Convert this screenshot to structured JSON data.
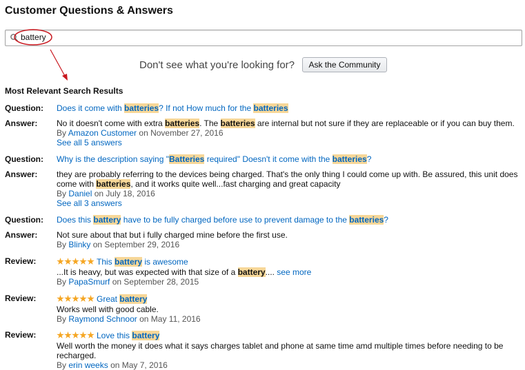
{
  "header": {
    "title": "Customer Questions & Answers"
  },
  "search": {
    "value": "battery",
    "icon": "search-icon"
  },
  "cta": {
    "text": "Don't see what you're looking for?",
    "button_label": "Ask the Community"
  },
  "results": {
    "heading": "Most Relevant Search Results",
    "labels": {
      "question": "Question:",
      "answer": "Answer:",
      "review": "Review:"
    },
    "qa": [
      {
        "question": [
          "Does it come with ",
          "batteries",
          "? If not How much for the ",
          "batteries"
        ],
        "answer": [
          "No it doesn't come with extra ",
          "batteries",
          ". The ",
          "batteries",
          " are internal but not sure if they are replaceable or if you can buy them."
        ],
        "by": "By",
        "author": "Amazon Customer",
        "date": "on November 27, 2016",
        "see_all": "See all 5 answers"
      },
      {
        "question": [
          "Why is the description saying \"",
          "Batteries",
          " required\" Doesn't it come with the ",
          "batteries",
          "?"
        ],
        "answer": [
          "they are probably referring to the devices being charged. That's the only thing I could come up with. Be assured, this unit does come with ",
          "batteries",
          ", and it works quite well...fast charging and great capacity"
        ],
        "by": "By",
        "author": "Daniel",
        "date": "on July 18, 2016",
        "see_all": "See all 3 answers"
      },
      {
        "question": [
          "Does this ",
          "battery",
          " have to be fully charged before use to prevent damage to the ",
          "batteries",
          "?"
        ],
        "answer": [
          "Not sure about that but i fully charged mine before the first use."
        ],
        "by": "By",
        "author": "Blinky",
        "date": "on September 29, 2016"
      }
    ],
    "reviews": [
      {
        "rating": 5,
        "title": [
          "This ",
          "battery",
          " is awesome"
        ],
        "body": [
          "...It is heavy, but was expected with that size of a ",
          "battery",
          ".... "
        ],
        "see_more": "see more",
        "by": "By",
        "author": "PapaSmurf",
        "date": "on September 28, 2015"
      },
      {
        "rating": 5,
        "title": [
          "Great ",
          "battery"
        ],
        "body": [
          "Works well with good cable."
        ],
        "by": "By",
        "author": "Raymond Schnoor",
        "date": "on May 11, 2016"
      },
      {
        "rating": 5,
        "title": [
          "Love this ",
          "battery"
        ],
        "body": [
          "Well worth the money it does what it says charges tablet and phone at same time amd multiple times before needing to be recharged."
        ],
        "by": "By",
        "author": "erin weeks",
        "date": "on May 7, 2016"
      }
    ]
  },
  "colors": {
    "link": "#0066c0",
    "highlight": "#f7d798",
    "annotation": "#c8161d",
    "star": "#f5a623"
  }
}
